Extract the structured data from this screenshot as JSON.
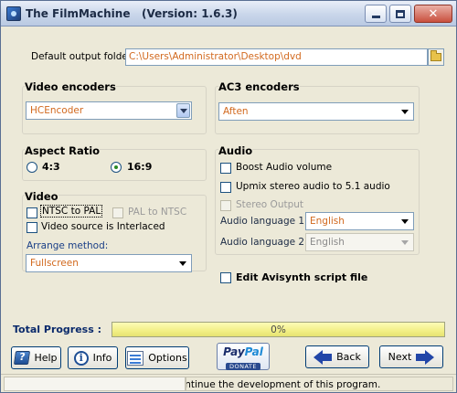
{
  "window": {
    "title": "The FilmMachine   (Version: 1.6.3)"
  },
  "output": {
    "label": "Default output folder:",
    "path": "C:\\Users\\Administrator\\Desktop\\dvd"
  },
  "video_encoders": {
    "title": "Video encoders",
    "selected": "HCEncoder"
  },
  "ac3_encoders": {
    "title": "AC3 encoders",
    "selected": "Aften"
  },
  "aspect_ratio": {
    "title": "Aspect Ratio",
    "options": [
      {
        "label": "4:3",
        "selected": false
      },
      {
        "label": "16:9",
        "selected": true
      }
    ]
  },
  "video": {
    "title": "Video",
    "ntsc_to_pal": "NTSC to PAL",
    "pal_to_ntsc": "PAL to NTSC",
    "interlaced": "Video source is Interlaced",
    "arrange_label": "Arrange method:",
    "arrange_selected": "Fullscreen"
  },
  "audio": {
    "title": "Audio",
    "boost": "Boost Audio volume",
    "upmix": "Upmix stereo audio to 5.1 audio",
    "stereo_output": "Stereo Output",
    "lang1_label": "Audio language 1:",
    "lang1_value": "English",
    "lang2_label": "Audio language 2:",
    "lang2_value": "English"
  },
  "avisynth": {
    "label": "Edit Avisynth script file"
  },
  "progress": {
    "label": "Total Progress :",
    "text": "0%",
    "value": 0
  },
  "buttons": {
    "help": "Help",
    "info": "Info",
    "options": "Options",
    "back": "Back",
    "next": "Next"
  },
  "donate": {
    "pay": "Pay",
    "pal": "Pal",
    "label": "DONATE"
  },
  "status": {
    "text": "continue the development of this program."
  },
  "icons": {
    "app": "app-icon",
    "folder": "folder-icon",
    "help": "help-icon",
    "info": "info-icon",
    "options": "options-icon",
    "back": "back-arrow-icon",
    "next": "next-arrow-icon"
  }
}
